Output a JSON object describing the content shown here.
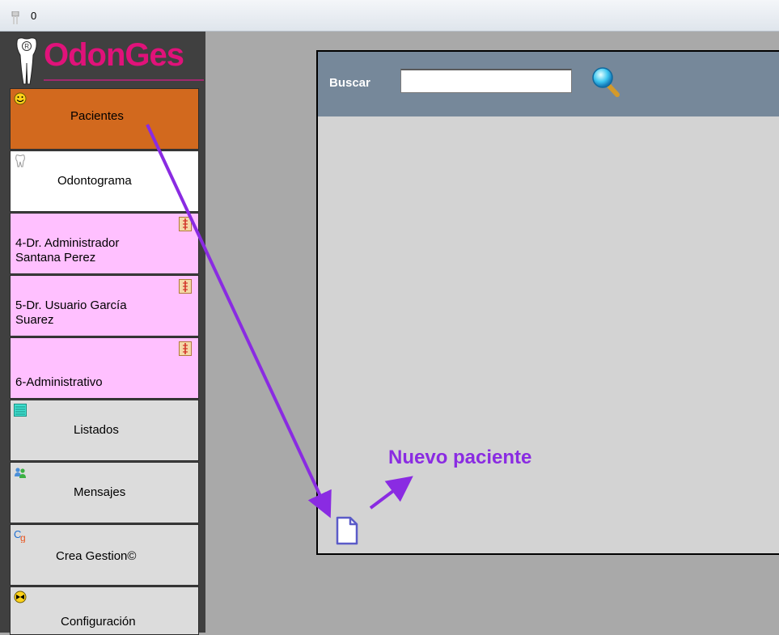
{
  "titlebar": {
    "count": "0"
  },
  "sidebar": {
    "logo_text": "OdonGes",
    "items": [
      {
        "label": "Pacientes",
        "icon": "smiley-icon",
        "bg": "#d2691e"
      },
      {
        "label": "Odontograma",
        "icon": "tooth-icon",
        "bg": "#ffffff"
      },
      {
        "label_line1": "4-Dr. Administrador",
        "label_line2": "Santana Perez",
        "bg": "#ffc0ff"
      },
      {
        "label_line1": "5-Dr. Usuario García",
        "label_line2": "Suarez",
        "bg": "#ffc0ff"
      },
      {
        "label": "6-Administrativo",
        "bg": "#ffc0ff"
      },
      {
        "label": "Listados",
        "icon": "list-icon",
        "bg": "#dcdcdc"
      },
      {
        "label": "Mensajes",
        "icon": "users-icon",
        "bg": "#dcdcdc"
      },
      {
        "label": "Crea Gestion©",
        "icon": "crea-gestion-icon",
        "bg": "#dcdcdc"
      },
      {
        "label": "Configuración",
        "icon": "config-icon",
        "bg": "#dcdcdc"
      }
    ]
  },
  "main": {
    "search_label": "Buscar",
    "search_value": "",
    "new_patient_annotation": "Nuevo paciente"
  },
  "colors": {
    "accent_annotation": "#8a2be2",
    "search_bar": "#76889a",
    "logo": "#e0127a"
  }
}
